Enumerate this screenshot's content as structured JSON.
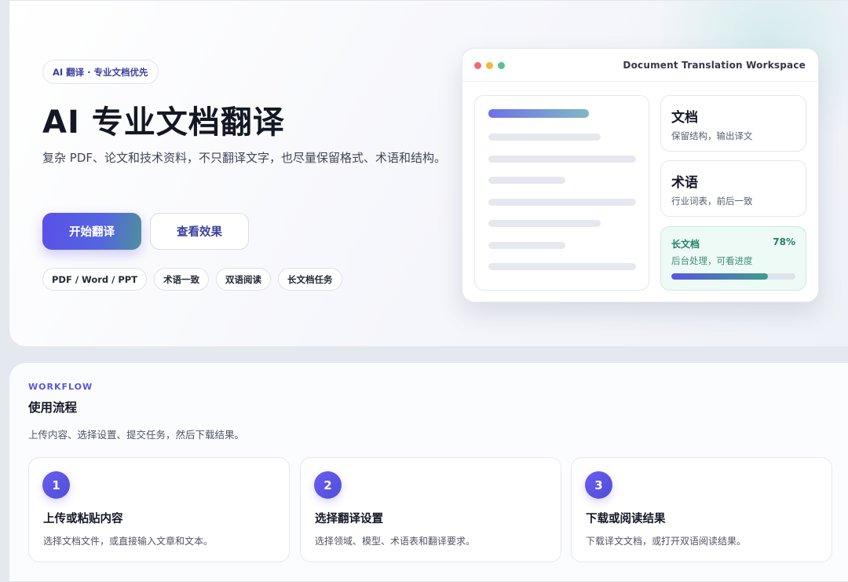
{
  "hero": {
    "eyebrow": "AI 翻译 · 专业文档优先",
    "title": "AI 专业文档翻译",
    "description": "复杂 PDF、论文和技术资料，不只翻译文字，也尽量保留格式、术语和结构。",
    "primary_button": "开始翻译",
    "secondary_button": "查看效果",
    "chips": [
      "PDF / Word / PPT",
      "术语一致",
      "双语阅读",
      "长文档任务"
    ]
  },
  "workspace": {
    "title": "Document Translation Workspace",
    "cards": [
      {
        "title": "文档",
        "subtitle": "保留结构，输出译文"
      },
      {
        "title": "术语",
        "subtitle": "行业词表，前后一致"
      }
    ],
    "progress": {
      "title": "长文档",
      "percent_label": "78%",
      "value": 0.78,
      "subtitle": "后台处理，可看进度"
    }
  },
  "workflow": {
    "eyebrow": "WORKFLOW",
    "title": "使用流程",
    "description": "上传内容、选择设置、提交任务，然后下载结果。",
    "steps": [
      {
        "number": "1",
        "title": "上传或粘贴内容",
        "description": "选择文档文件，或直接输入文章和文本。"
      },
      {
        "number": "2",
        "title": "选择翻译设置",
        "description": "选择领域、模型、术语表和翻译要求。"
      },
      {
        "number": "3",
        "title": "下载或阅读结果",
        "description": "下载译文文档，或打开双语阅读结果。"
      }
    ]
  },
  "colors": {
    "accent": "#5a50e8",
    "success": "#24806a"
  }
}
